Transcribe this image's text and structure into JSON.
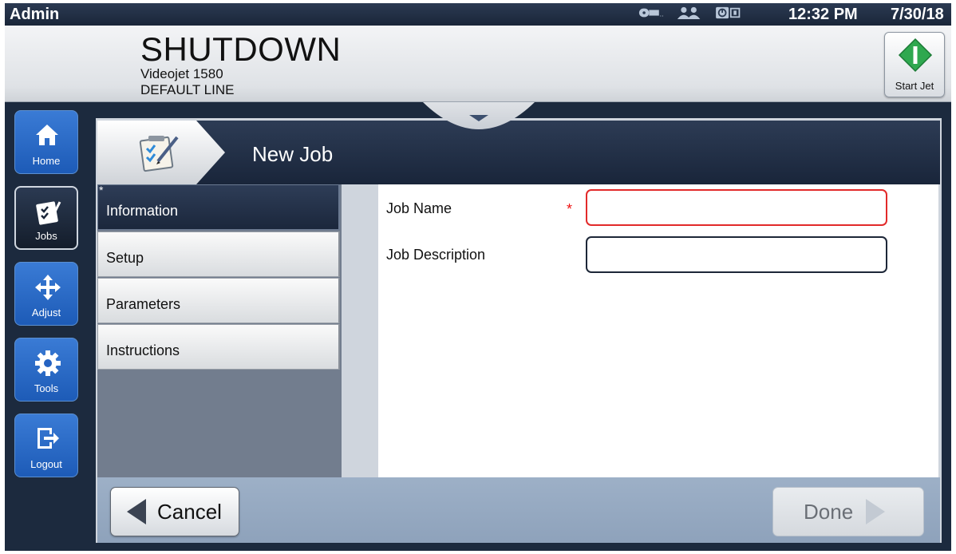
{
  "statusbar": {
    "user": "Admin",
    "time": "12:32 PM",
    "date": "7/30/18",
    "icons": [
      "jet-status-icon",
      "users-icon",
      "printhead-status-icon"
    ]
  },
  "header": {
    "state": "SHUTDOWN",
    "model": "Videojet 1580",
    "line": "DEFAULT LINE",
    "start_jet_label": "Start Jet"
  },
  "nav": {
    "items": [
      {
        "label": "Home",
        "icon": "home-icon"
      },
      {
        "label": "Jobs",
        "icon": "jobs-icon",
        "active": true
      },
      {
        "label": "Adjust",
        "icon": "move-arrows-icon"
      },
      {
        "label": "Tools",
        "icon": "gear-icon"
      },
      {
        "label": "Logout",
        "icon": "logout-icon"
      }
    ]
  },
  "page": {
    "title": "New Job",
    "icon": "checklist-icon"
  },
  "menu": {
    "modified_marker": "*",
    "items": [
      {
        "label": "Information",
        "active": true
      },
      {
        "label": "Setup"
      },
      {
        "label": "Parameters"
      },
      {
        "label": "Instructions"
      }
    ]
  },
  "form": {
    "job_name_label": "Job Name",
    "required_marker": "*",
    "job_name_value": "",
    "job_description_label": "Job Description",
    "job_description_value": ""
  },
  "footer": {
    "cancel_label": "Cancel",
    "done_label": "Done"
  },
  "colors": {
    "dark_navy": "#1c2a3e",
    "nav_blue": "#2a6ac8",
    "start_green": "#2fa84f",
    "error_red": "#e22a2a"
  }
}
